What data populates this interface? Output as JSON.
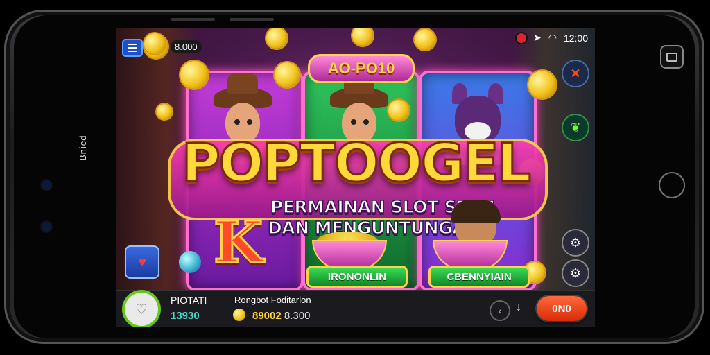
{
  "device": {
    "side_label": "Bnicd"
  },
  "status": {
    "time": "12:00"
  },
  "top": {
    "coin_balance": "8.000"
  },
  "game": {
    "badge": "AO-PO10",
    "title": "POPTOOGEL",
    "subtitle_line1": "PERMAINAN SLOT SERU",
    "subtitle_line2": "DAN MENGUNTUNGAN",
    "reel_button_1": "IRONONLIN",
    "reel_button_2": "CBENNYIAIN",
    "k_symbol": "K"
  },
  "bottom": {
    "player_label": "PIOTATI",
    "player_value": "13930",
    "bonus_label": "Rongbot Foditarlon",
    "bonus_value": "89002",
    "bonus_extra": "8.300",
    "spin_label": "0N0"
  },
  "icons": {
    "menu": "menu-icon",
    "coin": "coin-icon",
    "record": "record-icon",
    "location": "location-icon",
    "wifi": "wifi-icon",
    "right_x": "x-icon",
    "right_leaf": "leaf-icon",
    "gear": "gear-icon",
    "heart": "heart-icon",
    "back": "back-icon",
    "down": "down-arrow-icon"
  },
  "colors": {
    "title_gold": "#ffd83a",
    "reel_border": "#ff6fd0",
    "green_button": "#3adc54",
    "spin_button": "#ff6a3a",
    "player_value": "#44d8c8"
  }
}
